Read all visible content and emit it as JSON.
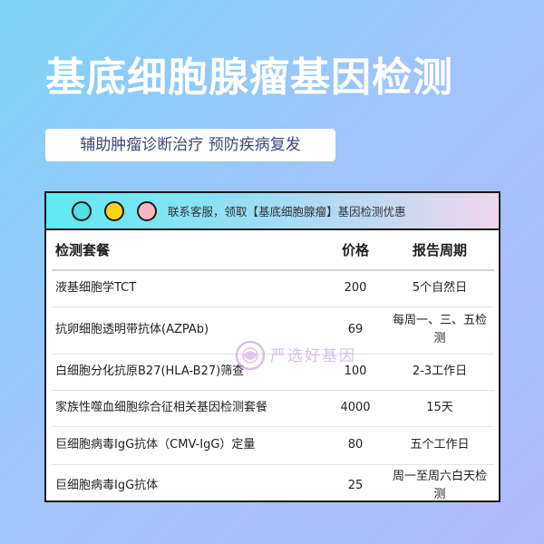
{
  "header": {
    "title": "基底细胞腺瘤基因检测",
    "subtitle": "辅助肿瘤诊断治疗 预防疾病复发"
  },
  "window": {
    "notice": "联系客服，领取【基底细胞腺瘤】基因检测优惠",
    "dot_colors": [
      "#4fe0e8",
      "#ffd21e",
      "#f6b7c2"
    ]
  },
  "table": {
    "headers": {
      "name": "检测套餐",
      "price": "价格",
      "period": "报告周期"
    },
    "rows": [
      {
        "name": "液基细胞学TCT",
        "price": "200",
        "period": "5个自然日"
      },
      {
        "name": "抗卵细胞透明带抗体(AZPAb)",
        "price": "69",
        "period": "每周一、三、五检测"
      },
      {
        "name": "白细胞分化抗原B27(HLA-B27)筛查",
        "price": "100",
        "period": "2-3工作日"
      },
      {
        "name": "家族性噬血细胞综合征相关基因检测套餐",
        "price": "4000",
        "period": "15天"
      },
      {
        "name": "巨细胞病毒IgG抗体（CMV-IgG）定量",
        "price": "80",
        "period": "五个工作日"
      },
      {
        "name": "巨细胞病毒IgG抗体",
        "price": "25",
        "period": "周一至周六白天检测"
      }
    ]
  },
  "watermark": {
    "text": "严选好基因",
    "icon": "logo-ring-icon"
  },
  "colors": {
    "accent_text": "#3d4a73",
    "border": "#1b1b1b"
  }
}
